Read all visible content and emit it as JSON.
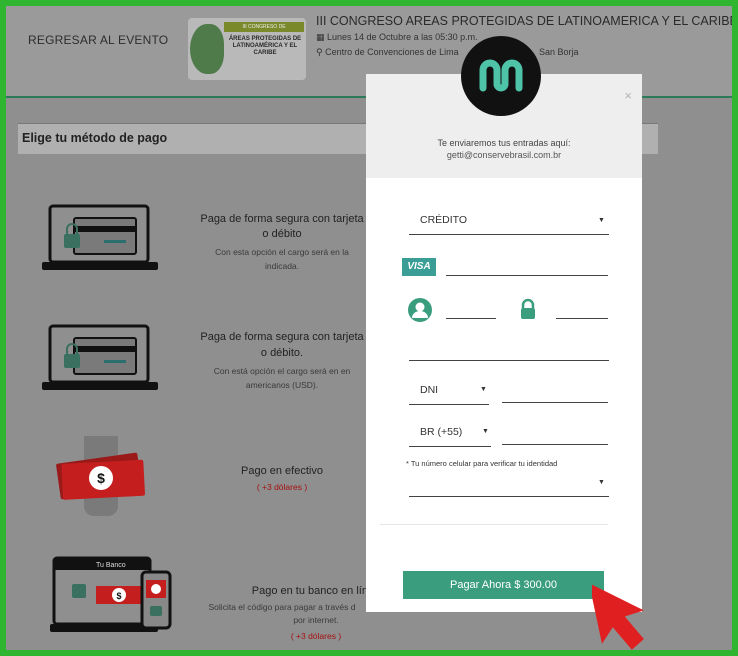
{
  "header": {
    "back_link": "REGRESAR AL EVENTO",
    "logo_band": "III CONGRESO DE",
    "logo_text": "ÁREAS PROTEGIDAS DE LATINOAMÉRICA Y EL CARIBE",
    "event_title": "III CONGRESO AREAS PROTEGIDAS DE LATINOAMERICA Y EL CARIBE",
    "event_date": "Lunes 14 de Octubre a las 05:30 p.m.",
    "event_venue": "Centro de Convenciones de Lima",
    "event_venue_district": "San Borja"
  },
  "main": {
    "section_title": "Elige tu método de pago",
    "options": [
      {
        "title_1": "Paga de forma segura con tarjeta",
        "title_2": "o débito",
        "desc_1": "Con esta opción el cargo será en la",
        "desc_2": "indicada."
      },
      {
        "title_1": "Paga de forma segura con tarjeta",
        "title_2": "o débito.",
        "desc_1": "Con está opción el cargo será en en",
        "desc_2": "americanos (USD)."
      },
      {
        "title_1": "Pago en efectivo",
        "extra": "( +3 dólares )"
      },
      {
        "title_1": "Pago en tu banco en línea",
        "desc_1": "Solicita el código para pagar a través d",
        "desc_2": "por internet.",
        "extra": "( +3 dólares )",
        "bank_label": "Tu Banco"
      }
    ]
  },
  "modal": {
    "close": "×",
    "send_label": "Te enviaremos tus entradas aquí:",
    "email": "getti@conservebrasil.com.br",
    "card_type": "CRÉDITO",
    "visa": "VISA",
    "doc_type": "DNI",
    "phone_code": "BR (+55)",
    "phone_hint": "* Tu número celular para verificar tu identidad",
    "pay_button": "Pagar Ahora $ 300.00"
  },
  "colors": {
    "frame": "#2fb52f",
    "accent": "#3a9d7e",
    "arrow": "#e02020"
  }
}
